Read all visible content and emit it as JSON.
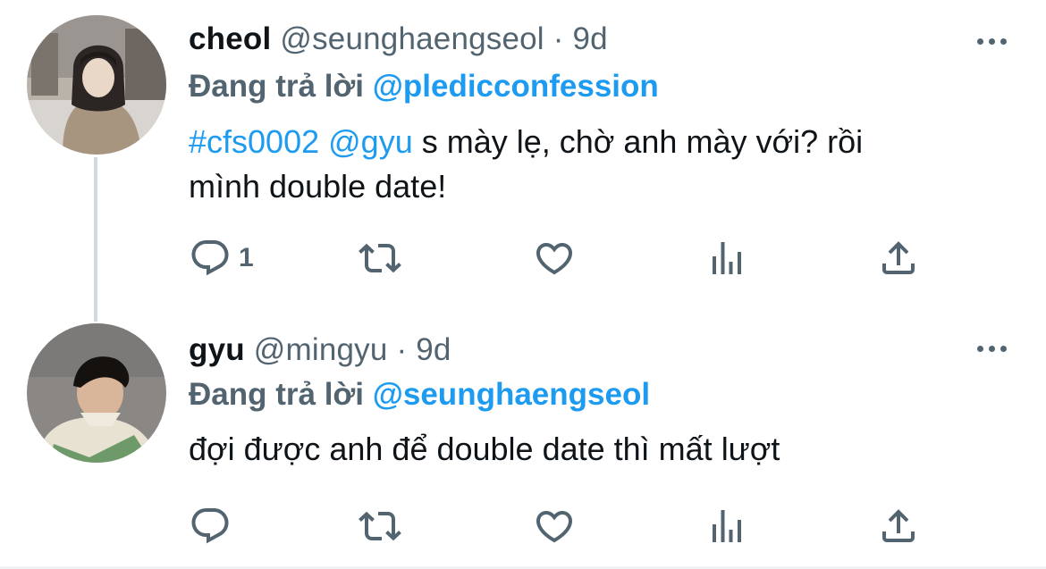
{
  "tweets": [
    {
      "display_name": "cheol",
      "handle": "@seunghaengseol",
      "separator": " · ",
      "time": "9d",
      "reply_prefix": "Đang trả lời ",
      "reply_to": "@pledicconfession",
      "body": {
        "hashtag": "#cfs0002",
        "mention": "@gyu",
        "text_line1": " s mày lẹ, chờ anh mày với? rồi",
        "text_line2": "mình double date!"
      },
      "reply_count": "1",
      "icons": [
        "reply-icon",
        "retweet-icon",
        "like-icon",
        "views-icon",
        "share-icon",
        "more-icon"
      ]
    },
    {
      "display_name": "gyu",
      "handle": "@mingyu",
      "separator": " · ",
      "time": "9d",
      "reply_prefix": "Đang trả lời ",
      "reply_to": "@seunghaengseol",
      "body": {
        "text": "đợi được anh để double date thì mất lượt"
      },
      "reply_count": "",
      "icons": [
        "reply-icon",
        "retweet-icon",
        "like-icon",
        "views-icon",
        "share-icon",
        "more-icon"
      ]
    }
  ],
  "colors": {
    "link": "#1d9bf0",
    "secondary_text": "#536471",
    "primary_text": "#0f1419",
    "thread_line": "#cfd9de"
  }
}
